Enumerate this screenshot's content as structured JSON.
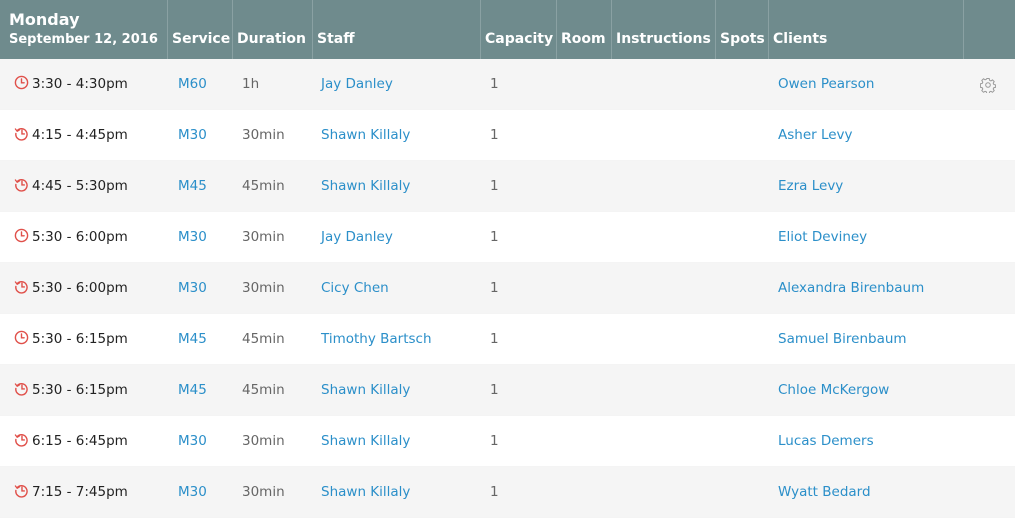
{
  "header": {
    "day": "Monday",
    "date": "September 12, 2016",
    "columns": {
      "service": "Service",
      "duration": "Duration",
      "staff": "Staff",
      "capacity": "Capacity",
      "room": "Room",
      "instructions": "Instructions",
      "spots": "Spots",
      "clients": "Clients"
    }
  },
  "colors": {
    "header_bg": "#6f8b8d",
    "link": "#2b8fc9",
    "icon": "#e0504a"
  },
  "rows": [
    {
      "time": "3:30 - 4:30pm",
      "icon": "clock-icon",
      "service": "M60",
      "duration": "1h",
      "staff": "Jay Danley",
      "capacity": "1",
      "client": "Owen Pearson"
    },
    {
      "time": "4:15 - 4:45pm",
      "icon": "history-icon",
      "service": "M30",
      "duration": "30min",
      "staff": "Shawn Killaly",
      "capacity": "1",
      "client": "Asher Levy"
    },
    {
      "time": "4:45 - 5:30pm",
      "icon": "history-icon",
      "service": "M45",
      "duration": "45min",
      "staff": "Shawn Killaly",
      "capacity": "1",
      "client": "Ezra Levy"
    },
    {
      "time": "5:30 - 6:00pm",
      "icon": "clock-icon",
      "service": "M30",
      "duration": "30min",
      "staff": "Jay Danley",
      "capacity": "1",
      "client": "Eliot Deviney"
    },
    {
      "time": "5:30 - 6:00pm",
      "icon": "history-icon",
      "service": "M30",
      "duration": "30min",
      "staff": "Cicy Chen",
      "capacity": "1",
      "client": "Alexandra Birenbaum"
    },
    {
      "time": "5:30 - 6:15pm",
      "icon": "clock-icon",
      "service": "M45",
      "duration": "45min",
      "staff": "Timothy Bartsch",
      "capacity": "1",
      "client": "Samuel Birenbaum"
    },
    {
      "time": "5:30 - 6:15pm",
      "icon": "history-icon",
      "service": "M45",
      "duration": "45min",
      "staff": "Shawn Killaly",
      "capacity": "1",
      "client": "Chloe McKergow"
    },
    {
      "time": "6:15 - 6:45pm",
      "icon": "history-icon",
      "service": "M30",
      "duration": "30min",
      "staff": "Shawn Killaly",
      "capacity": "1",
      "client": "Lucas Demers"
    },
    {
      "time": "7:15 - 7:45pm",
      "icon": "history-icon",
      "service": "M30",
      "duration": "30min",
      "staff": "Shawn Killaly",
      "capacity": "1",
      "client": "Wyatt Bedard"
    }
  ]
}
